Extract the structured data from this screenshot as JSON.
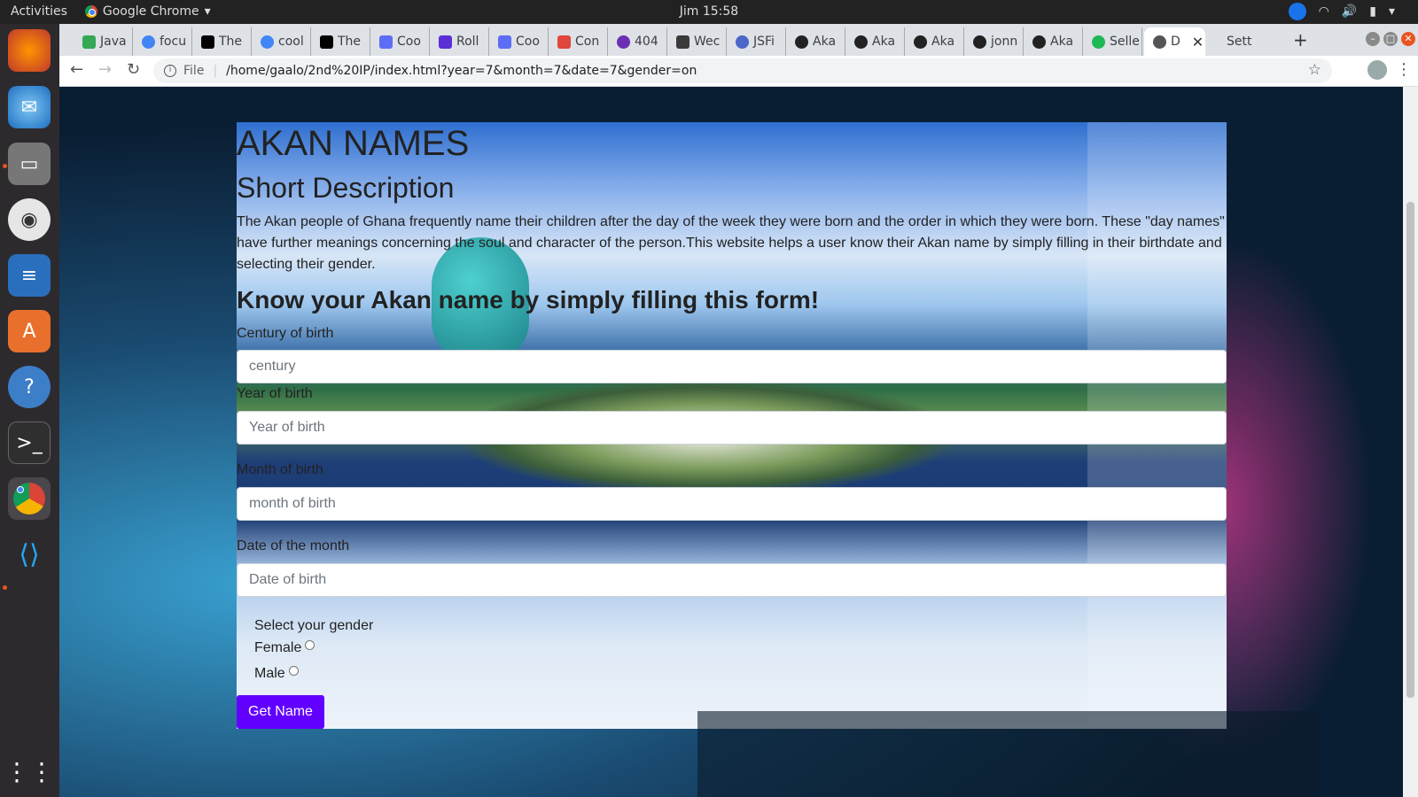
{
  "topbar": {
    "activities": "Activities",
    "app_name": "Google Chrome",
    "clock": "Jim 15:58"
  },
  "dock": {
    "items": [
      "firefox-icon",
      "thunderbird-icon",
      "files-icon",
      "rhythmbox-icon",
      "libreoffice-writer-icon",
      "software-center-icon",
      "help-icon",
      "terminal-icon",
      "chrome-icon",
      "vscode-icon"
    ],
    "show_apps_icon": "apps-grid-icon"
  },
  "browser": {
    "tabs": [
      {
        "label": "Java",
        "color": "#34a853"
      },
      {
        "label": "focu",
        "color": "#4285f4"
      },
      {
        "label": "The",
        "color": "#000000"
      },
      {
        "label": "cool",
        "color": "#4285f4"
      },
      {
        "label": "The",
        "color": "#000000"
      },
      {
        "label": "Coo",
        "color": "#5b6ef5"
      },
      {
        "label": "Roll",
        "color": "#5b2fd6"
      },
      {
        "label": "Coo",
        "color": "#5b6ef5"
      },
      {
        "label": "Con",
        "color": "#e0463c"
      },
      {
        "label": "404",
        "color": "#6b2fb3"
      },
      {
        "label": "Wec",
        "color": "#3a3a3a"
      },
      {
        "label": "JSFi",
        "color": "#4a66c9"
      },
      {
        "label": "Aka",
        "color": "#222222"
      },
      {
        "label": "Aka",
        "color": "#222222"
      },
      {
        "label": "Aka",
        "color": "#222222"
      },
      {
        "label": "jonn",
        "color": "#222222"
      },
      {
        "label": "Aka",
        "color": "#222222"
      },
      {
        "label": "Selle",
        "color": "#1db954"
      },
      {
        "label": "D",
        "color": "#555555",
        "active": true
      },
      {
        "label": "Sett",
        "color": "#777777"
      }
    ],
    "new_tab": "+",
    "url_file_label": "File",
    "url": "/home/gaalo/2nd%20IP/index.html?year=7&month=7&date=7&gender=on"
  },
  "page": {
    "title": "AKAN NAMES",
    "subtitle": "Short Description",
    "description": "The Akan people of Ghana frequently name their children after the day of the week they were born and the order in which they were born. These \"day names\" have further meanings concerning the soul and character of the person.This website helps a user know their Akan name by simply filling in their birthdate and selecting their gender.",
    "form_heading": "Know your Akan name by simply filling this form!",
    "century_label": "Century of birth",
    "century_placeholder": "century",
    "year_label": "Year of birth",
    "year_placeholder": "Year of birth",
    "month_label": "Month of birth",
    "month_placeholder": "month of birth",
    "date_label": "Date of the month",
    "date_placeholder": "Date of birth",
    "gender_label": "Select your gender",
    "female_label": "Female",
    "male_label": "Male",
    "submit_label": "Get Name",
    "accent_color": "#6200ff"
  }
}
